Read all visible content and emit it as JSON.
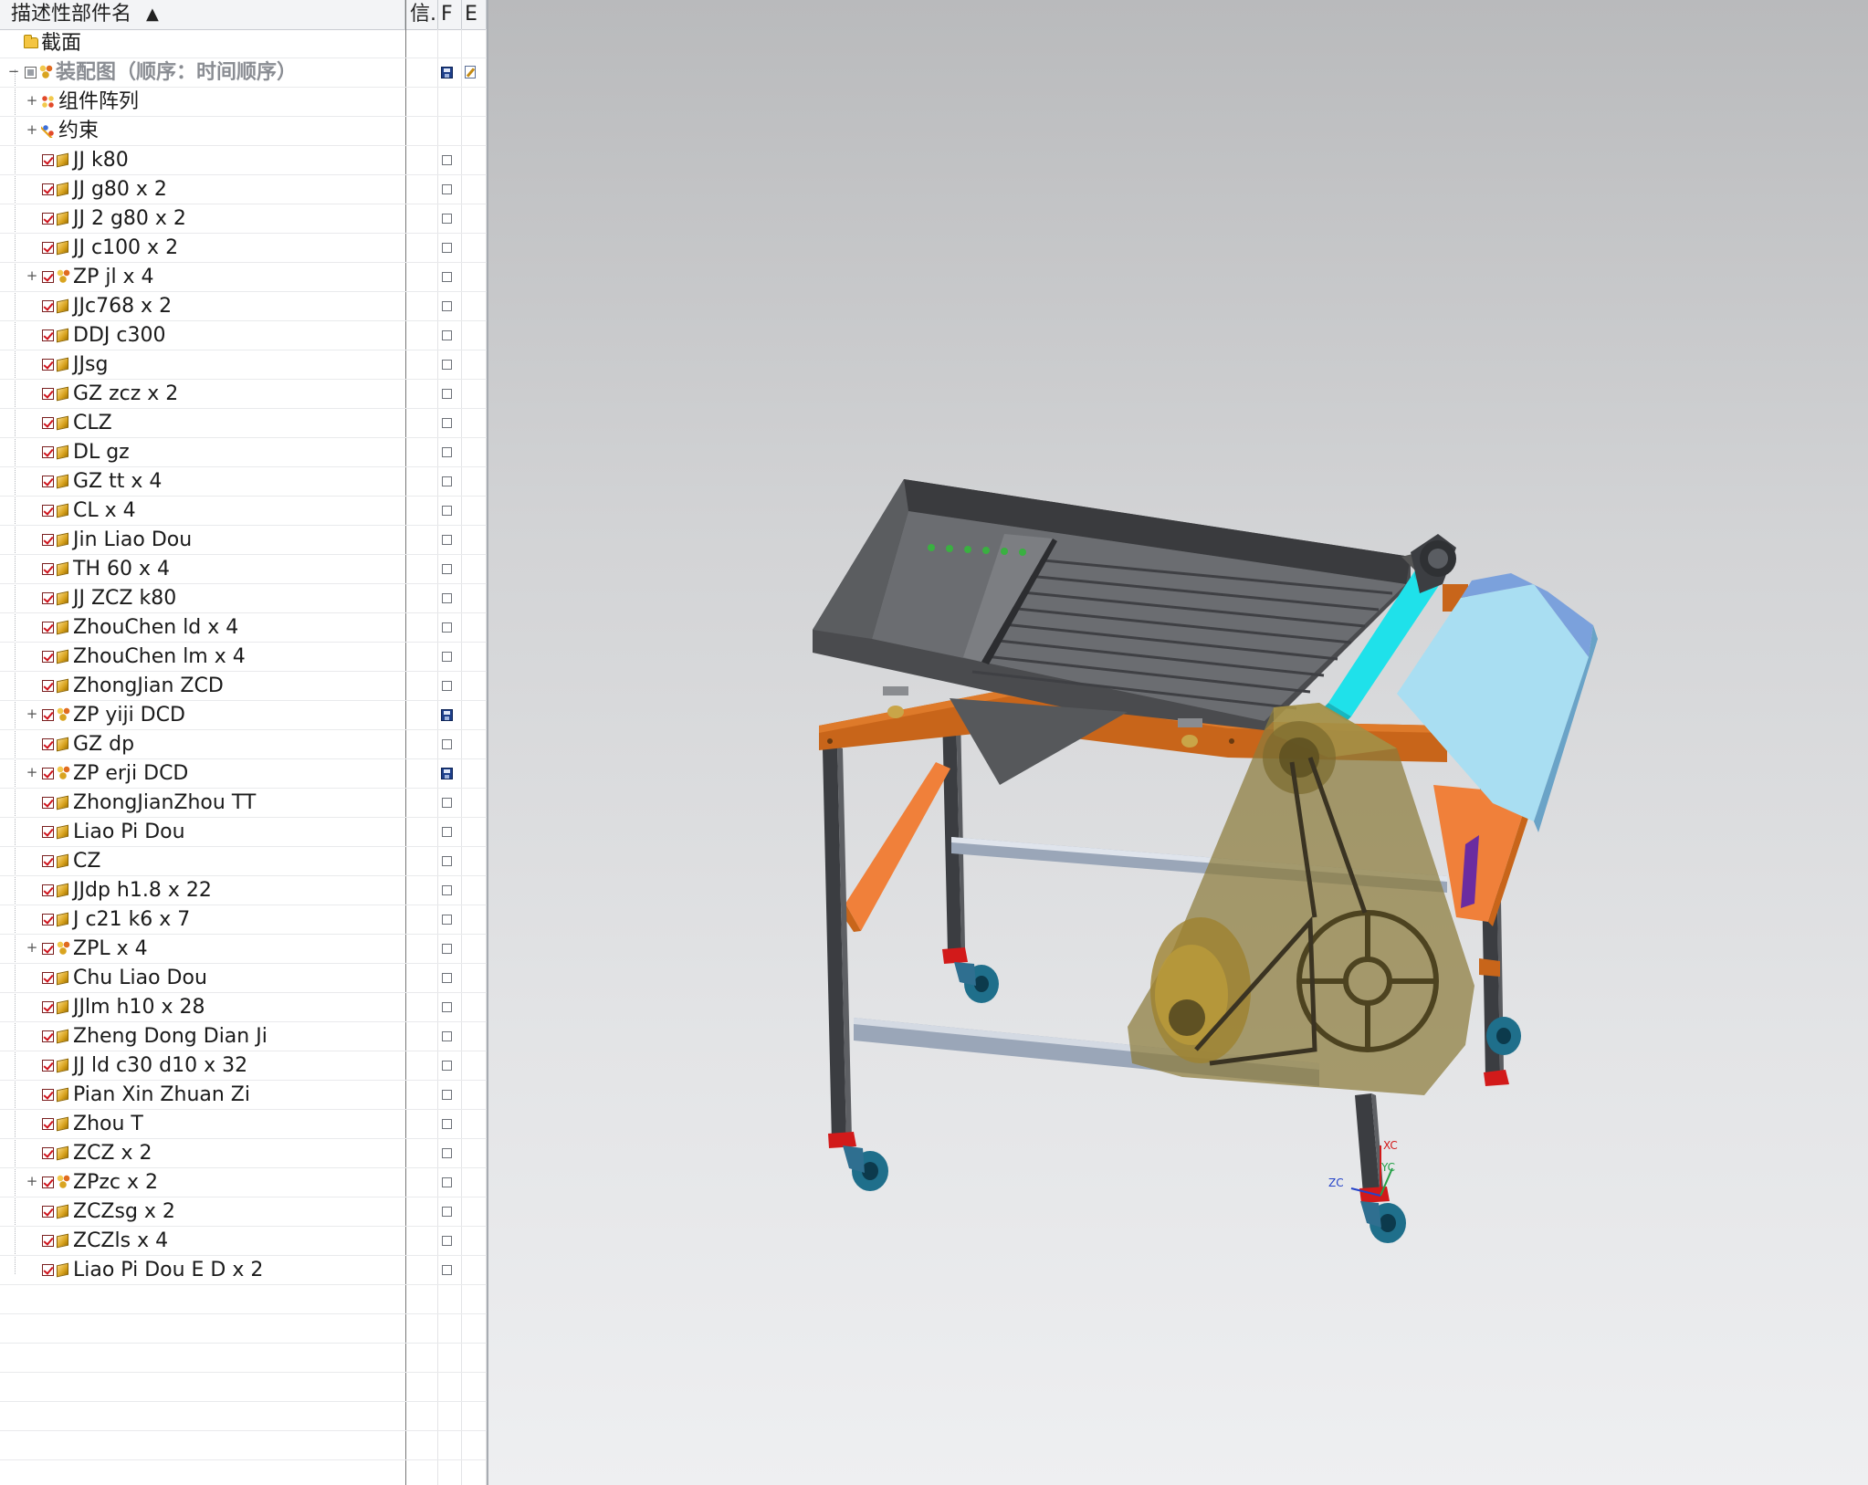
{
  "navigator": {
    "columns": {
      "name": "描述性部件名",
      "info": "信.",
      "c3": "F",
      "c4": "E"
    },
    "rows": [
      {
        "label": "截面",
        "type": "folder",
        "expander": "",
        "col3": "none"
      },
      {
        "label": "装配图（顺序：时间顺序）",
        "type": "root",
        "expander": "−",
        "col3": "save",
        "col4": "edit",
        "dim": true
      },
      {
        "label": "组件阵列",
        "type": "array",
        "expander": "+",
        "col3": "none"
      },
      {
        "label": "约束",
        "type": "constraint",
        "expander": "+",
        "col3": "none"
      },
      {
        "label": "JJ k80",
        "type": "part",
        "expander": "",
        "col3": "box"
      },
      {
        "label": "JJ g80 x 2",
        "type": "part",
        "expander": "",
        "col3": "box"
      },
      {
        "label": "JJ 2 g80 x 2",
        "type": "part",
        "expander": "",
        "col3": "box"
      },
      {
        "label": "JJ c100 x 2",
        "type": "part",
        "expander": "",
        "col3": "box"
      },
      {
        "label": "ZP jl x 4",
        "type": "assembly",
        "expander": "+",
        "col3": "box"
      },
      {
        "label": "JJc768 x 2",
        "type": "part",
        "expander": "",
        "col3": "box"
      },
      {
        "label": "DDJ c300",
        "type": "part",
        "expander": "",
        "col3": "box"
      },
      {
        "label": "JJsg",
        "type": "part",
        "expander": "",
        "col3": "box"
      },
      {
        "label": "GZ zcz x 2",
        "type": "part",
        "expander": "",
        "col3": "box"
      },
      {
        "label": "CLZ",
        "type": "part",
        "expander": "",
        "col3": "box"
      },
      {
        "label": "DL gz",
        "type": "part",
        "expander": "",
        "col3": "box"
      },
      {
        "label": "GZ tt x 4",
        "type": "part",
        "expander": "",
        "col3": "box"
      },
      {
        "label": "CL x 4",
        "type": "part",
        "expander": "",
        "col3": "box"
      },
      {
        "label": "Jin Liao Dou",
        "type": "part",
        "expander": "",
        "col3": "box"
      },
      {
        "label": "TH 60 x 4",
        "type": "part",
        "expander": "",
        "col3": "box"
      },
      {
        "label": "JJ ZCZ k80",
        "type": "part",
        "expander": "",
        "col3": "box"
      },
      {
        "label": "ZhouChen ld x 4",
        "type": "part",
        "expander": "",
        "col3": "box"
      },
      {
        "label": "ZhouChen lm x 4",
        "type": "part",
        "expander": "",
        "col3": "box"
      },
      {
        "label": "ZhongJian ZCD",
        "type": "part",
        "expander": "",
        "col3": "box"
      },
      {
        "label": "ZP yiji DCD",
        "type": "assembly",
        "expander": "+",
        "col3": "save"
      },
      {
        "label": "GZ dp",
        "type": "part",
        "expander": "",
        "col3": "box"
      },
      {
        "label": "ZP erji DCD",
        "type": "assembly",
        "expander": "+",
        "col3": "save"
      },
      {
        "label": "ZhongJianZhou TT",
        "type": "part",
        "expander": "",
        "col3": "box"
      },
      {
        "label": "Liao Pi Dou",
        "type": "part",
        "expander": "",
        "col3": "box"
      },
      {
        "label": "CZ",
        "type": "part",
        "expander": "",
        "col3": "box"
      },
      {
        "label": "JJdp h1.8 x 22",
        "type": "part",
        "expander": "",
        "col3": "box"
      },
      {
        "label": "J c21 k6 x 7",
        "type": "part",
        "expander": "",
        "col3": "box"
      },
      {
        "label": "ZPL x 4",
        "type": "assembly",
        "expander": "+",
        "col3": "box"
      },
      {
        "label": "Chu Liao Dou",
        "type": "part",
        "expander": "",
        "col3": "box"
      },
      {
        "label": "JJlm h10 x 28",
        "type": "part",
        "expander": "",
        "col3": "box"
      },
      {
        "label": "Zheng Dong Dian Ji",
        "type": "part",
        "expander": "",
        "col3": "box"
      },
      {
        "label": "JJ ld c30 d10 x 32",
        "type": "part",
        "expander": "",
        "col3": "box"
      },
      {
        "label": "Pian Xin Zhuan Zi",
        "type": "part",
        "expander": "",
        "col3": "box"
      },
      {
        "label": "Zhou T",
        "type": "part",
        "expander": "",
        "col3": "box"
      },
      {
        "label": "ZCZ x 2",
        "type": "part",
        "expander": "",
        "col3": "box"
      },
      {
        "label": "ZPzc x 2",
        "type": "assembly",
        "expander": "+",
        "col3": "box"
      },
      {
        "label": "ZCZsg x 2",
        "type": "part",
        "expander": "",
        "col3": "box"
      },
      {
        "label": "ZCZls x 4",
        "type": "part",
        "expander": "",
        "col3": "box"
      },
      {
        "label": "Liao Pi Dou E D x 2",
        "type": "part",
        "expander": "",
        "col3": "box"
      }
    ],
    "empty_rows": 7
  },
  "viewport": {
    "axis_labels": {
      "x": "XC",
      "z": "ZC",
      "y": "YC"
    },
    "colors": {
      "hopper": "#4a4b4e",
      "frame_orange": "#c8651a",
      "frame_light_orange": "#f0803a",
      "leg": "#3b3d41",
      "chute_blue": "#a9def2",
      "roller_cyan": "#1fe1ea",
      "guard_olive": "#8c7b3b",
      "caster_blue": "#1f6f8b",
      "caster_red": "#d21a1a"
    }
  }
}
